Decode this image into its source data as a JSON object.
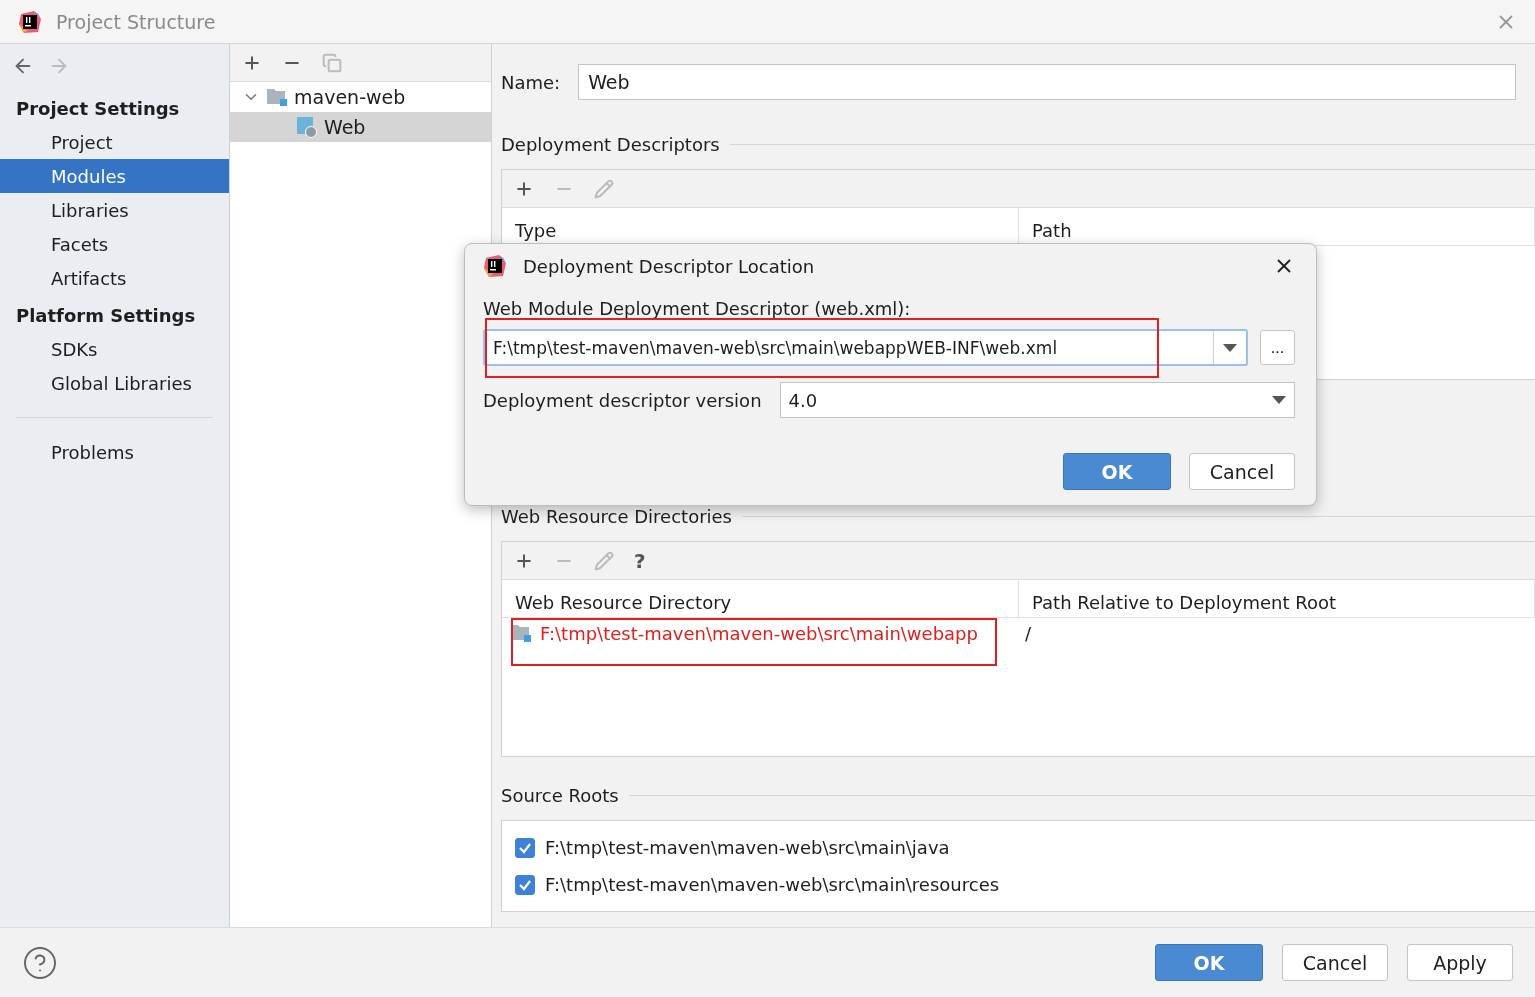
{
  "window": {
    "title": "Project Structure"
  },
  "sidebar": {
    "groups": [
      {
        "title": "Project Settings",
        "items": [
          {
            "label": "Project",
            "selected": false
          },
          {
            "label": "Modules",
            "selected": true
          },
          {
            "label": "Libraries",
            "selected": false
          },
          {
            "label": "Facets",
            "selected": false
          },
          {
            "label": "Artifacts",
            "selected": false
          }
        ]
      },
      {
        "title": "Platform Settings",
        "items": [
          {
            "label": "SDKs",
            "selected": false
          },
          {
            "label": "Global Libraries",
            "selected": false
          }
        ]
      }
    ],
    "bottom_items": [
      {
        "label": "Problems",
        "selected": false
      }
    ]
  },
  "tree": [
    {
      "label": "maven-web",
      "expanded": true,
      "selected": false,
      "children": [
        {
          "label": "Web",
          "selected": true
        }
      ]
    }
  ],
  "name_field": {
    "label": "Name:",
    "value": "Web"
  },
  "deployment_descriptors": {
    "title": "Deployment Descriptors",
    "columns": [
      "Type",
      "Path"
    ]
  },
  "web_resource_directories": {
    "title": "Web Resource Directories",
    "help_glyph": "?",
    "columns": [
      "Web Resource Directory",
      "Path Relative to Deployment Root"
    ],
    "rows": [
      {
        "directory": "F:\\tmp\\test-maven\\maven-web\\src\\main\\webapp",
        "path": "/",
        "invalid": true,
        "highlighted": true
      }
    ]
  },
  "source_roots": {
    "title": "Source Roots",
    "items": [
      {
        "label": "F:\\tmp\\test-maven\\maven-web\\src\\main\\java",
        "checked": true
      },
      {
        "label": "F:\\tmp\\test-maven\\maven-web\\src\\main\\resources",
        "checked": true
      }
    ]
  },
  "footer": {
    "buttons": [
      {
        "label": "OK",
        "kind": "primary"
      },
      {
        "label": "Cancel",
        "kind": "normal"
      },
      {
        "label": "Apply",
        "kind": "normal"
      }
    ]
  },
  "dialog": {
    "title": "Deployment Descriptor Location",
    "location_label": "Web Module Deployment Descriptor (web.xml):",
    "location_value": "F:\\tmp\\test-maven\\maven-web\\src\\main\\webappWEB-INF\\web.xml",
    "location_highlighted": true,
    "browse_label": "...",
    "version_label": "Deployment descriptor version",
    "version_value": "4.0",
    "buttons": [
      {
        "label": "OK",
        "kind": "primary"
      },
      {
        "label": "Cancel",
        "kind": "normal"
      }
    ]
  }
}
